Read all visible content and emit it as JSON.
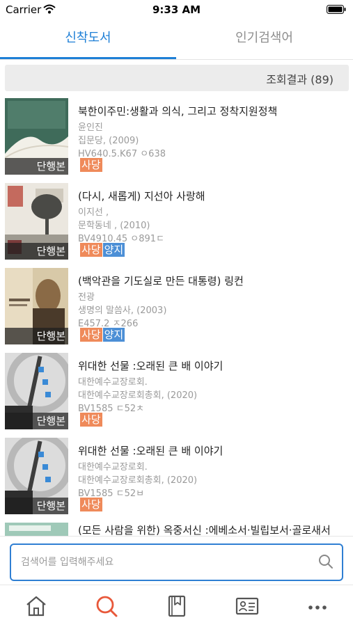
{
  "status": {
    "carrier": "Carrier",
    "time": "9:33 AM"
  },
  "tabs": [
    {
      "label": "신착도서",
      "active": true
    },
    {
      "label": "인기검색어",
      "active": false
    }
  ],
  "result_count_text": "조회결과 (89)",
  "books": [
    {
      "title": "북한이주민:생활과 의식, 그리고 정착지원정책",
      "author": "윤인진",
      "publisher": "집문당, (2009)",
      "call_number": "HV640.5.K67 ㅇ638",
      "format": "단행본",
      "locations": [
        "사당"
      ]
    },
    {
      "title": "(다시, 새롭게) 지선아 사랑해",
      "author": "이지선 ,",
      "publisher": "문학동네 , (2010)",
      "call_number": "BV4910.45 ㅇ891ㄷ",
      "format": "단행본",
      "locations": [
        "사당",
        "양지"
      ]
    },
    {
      "title": "(백악관을 기도실로 만든 대통령) 링컨",
      "author": "전광",
      "publisher": "생명의 말씀사, (2003)",
      "call_number": "E457.2 ㅈ266",
      "format": "단행본",
      "locations": [
        "사당",
        "양지"
      ]
    },
    {
      "title": "위대한 선물  :오래된 큰 배 이야기",
      "author": "대한예수교장로회.",
      "publisher": "대한예수교장로회총회, (2020)",
      "call_number": "BV1585 ㄷ52ㅊ",
      "format": "단행본",
      "locations": [
        "사당"
      ]
    },
    {
      "title": "위대한 선물 :오래된 큰 배 이야기",
      "author": "대한예수교장로회.",
      "publisher": "대한예수교장로회총회, (2020)",
      "call_number": "BV1585 ㄷ52ㅂ",
      "format": "단행본",
      "locations": [
        "사당"
      ]
    },
    {
      "title": "(모든 사람을 위한) 옥중서신 :에베소서·빌립보서·골로새서"
    }
  ],
  "search": {
    "placeholder": "검색어를 입력해주세요",
    "value": ""
  },
  "bottom_nav": [
    {
      "icon": "home-icon"
    },
    {
      "icon": "search-icon"
    },
    {
      "icon": "bookmark-book-icon"
    },
    {
      "icon": "library-card-icon"
    },
    {
      "icon": "more-icon"
    }
  ],
  "colors": {
    "accent": "#1e7fd6",
    "tag_sadang": "#ef8a5a",
    "tag_yangji": "#4c8fd6",
    "active_nav": "#e8583a"
  }
}
